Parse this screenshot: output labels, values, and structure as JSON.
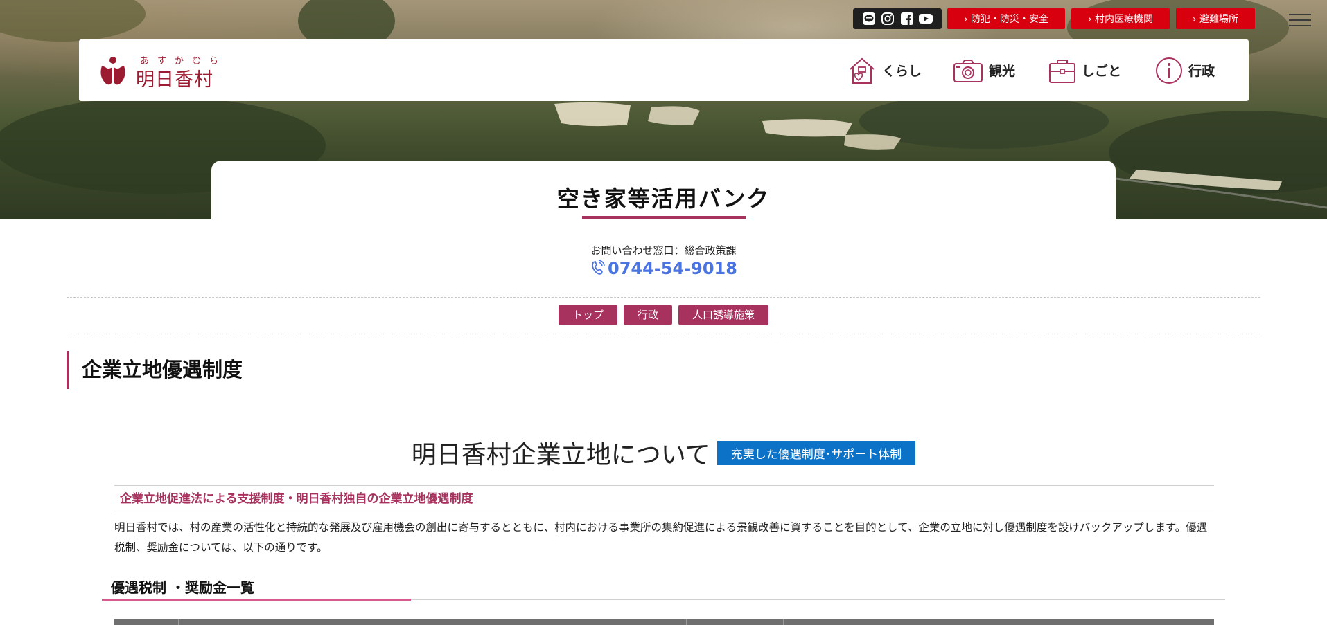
{
  "colors": {
    "brand": "#a8325e",
    "alert_red": "#d8000f",
    "phone_blue": "#4a74e0",
    "tag_blue": "#0c72c8"
  },
  "sns": [
    {
      "name": "line-icon"
    },
    {
      "name": "instagram-icon"
    },
    {
      "name": "facebook-icon"
    },
    {
      "name": "youtube-icon"
    }
  ],
  "quick_links": [
    {
      "label": "› 防犯・防災・安全"
    },
    {
      "label": "› 村内医療機関"
    },
    {
      "label": "› 避難場所"
    }
  ],
  "logo": {
    "ruby": "あすかむら",
    "text": "明日香村"
  },
  "nav": [
    {
      "label": "くらし",
      "icon": "house-heart-icon"
    },
    {
      "label": "観光",
      "icon": "camera-icon"
    },
    {
      "label": "しごと",
      "icon": "briefcase-icon"
    },
    {
      "label": "行政",
      "icon": "info-icon"
    }
  ],
  "page_title": "空き家等活用バンク",
  "contact": {
    "label": "お問い合わせ窓口：総合政策課",
    "phone": "0744-54-9018"
  },
  "breadcrumbs": [
    "トップ",
    "行政",
    "人口誘導施策"
  ],
  "heading1": "企業立地優遇制度",
  "heading2": {
    "text": "明日香村企業立地について",
    "tag": "充実した優遇制度･サポート体制"
  },
  "subheading": "企業立地促進法による支援制度・明日香村独自の企業立地優遇制度",
  "body": "明日香村では、村の産業の活性化と持続的な発展及び雇用機会の創出に寄与するとともに、村内における事業所の集約促進による景観改善に資することを目的として、企業の立地に対し優遇制度を設けバックアップします。優遇税制、奨励金については、以下の通りです。",
  "heading3": "優遇税制 ・奨励金一覧"
}
